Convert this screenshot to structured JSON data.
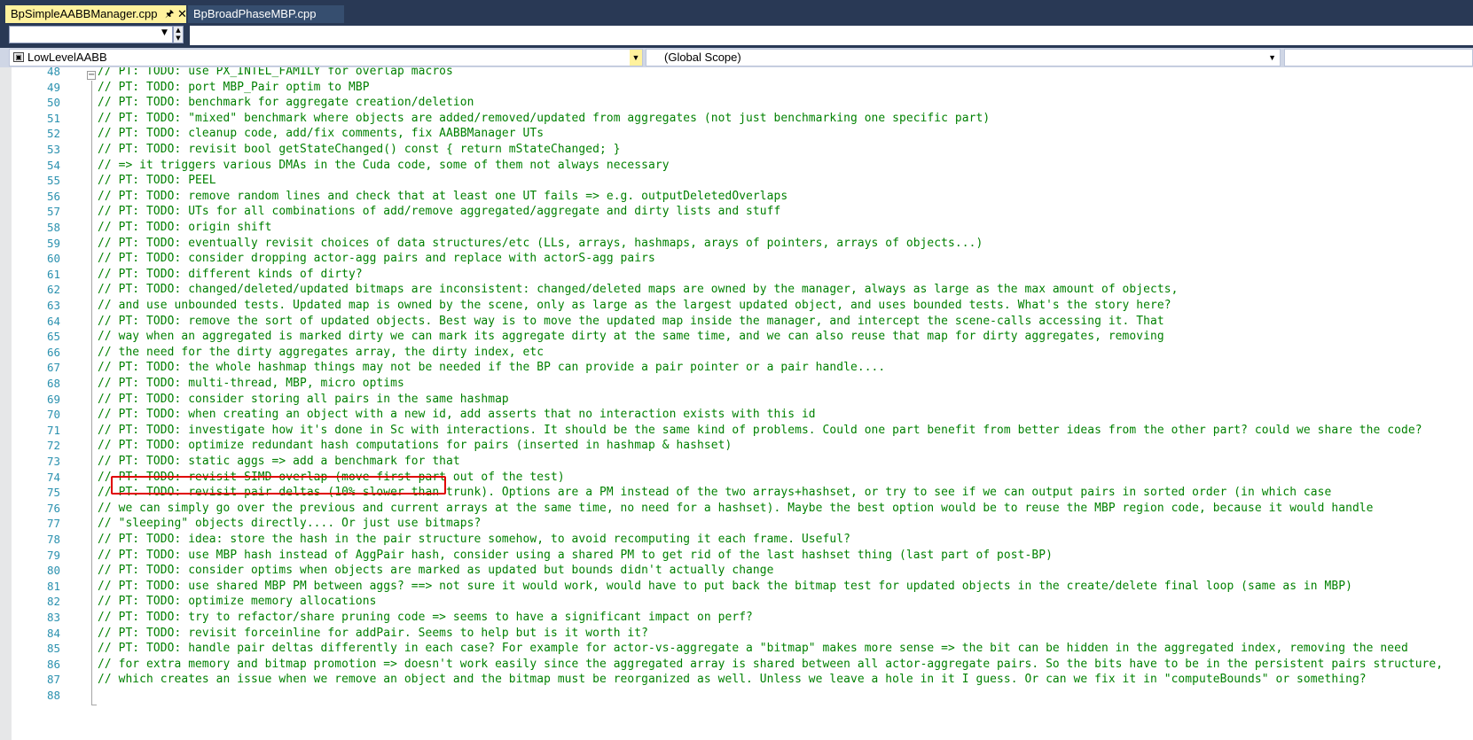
{
  "tabs": [
    {
      "label": "BpSimpleAABBManager.cpp",
      "active": true,
      "pin_icon": "pin-icon",
      "close_icon": "close-icon"
    },
    {
      "label": "BpBroadPhaseMBP.cpp",
      "active": false
    }
  ],
  "navigation": {
    "class_combo": "LowLevelAABB",
    "scope_combo": "(Global Scope)"
  },
  "editor": {
    "first_line_number": 48,
    "highlighted_line": 73,
    "lines": [
      {
        "n": "48",
        "text": "// PT: TODO: use PX_INTEL_FAMILY for overlap macros"
      },
      {
        "n": "49",
        "text": "// PT: TODO: port MBP_Pair optim to MBP"
      },
      {
        "n": "50",
        "text": "// PT: TODO: benchmark for aggregate creation/deletion"
      },
      {
        "n": "51",
        "text": "// PT: TODO: \"mixed\" benchmark where objects are added/removed/updated from aggregates (not just benchmarking one specific part)"
      },
      {
        "n": "52",
        "text": "// PT: TODO: cleanup code, add/fix comments, fix AABBManager UTs"
      },
      {
        "n": "53",
        "text": "// PT: TODO: revisit bool getStateChanged() const { return mStateChanged; }"
      },
      {
        "n": "54",
        "text": "// => it triggers various DMAs in the Cuda code, some of them not always necessary"
      },
      {
        "n": "55",
        "text": "// PT: TODO: PEEL"
      },
      {
        "n": "56",
        "text": "// PT: TODO: remove random lines and check that at least one UT fails => e.g. outputDeletedOverlaps"
      },
      {
        "n": "57",
        "text": "// PT: TODO: UTs for all combinations of add/remove aggregated/aggregate and dirty lists and stuff"
      },
      {
        "n": "58",
        "text": "// PT: TODO: origin shift"
      },
      {
        "n": "59",
        "text": "// PT: TODO: eventually revisit choices of data structures/etc (LLs, arrays, hashmaps, arays of pointers, arrays of objects...)"
      },
      {
        "n": "60",
        "text": "// PT: TODO: consider dropping actor-agg pairs and replace with actorS-agg pairs"
      },
      {
        "n": "61",
        "text": "// PT: TODO: different kinds of dirty?"
      },
      {
        "n": "62",
        "text": "// PT: TODO: changed/deleted/updated bitmaps are inconsistent: changed/deleted maps are owned by the manager, always as large as the max amount of objects,"
      },
      {
        "n": "63",
        "text": "// and use unbounded tests. Updated map is owned by the scene, only as large as the largest updated object, and uses bounded tests. What's the story here?"
      },
      {
        "n": "64",
        "text": "// PT: TODO: remove the sort of updated objects. Best way is to move the updated map inside the manager, and intercept the scene-calls accessing it. That"
      },
      {
        "n": "65",
        "text": "// way when an aggregated is marked dirty we can mark its aggregate dirty at the same time, and we can also reuse that map for dirty aggregates, removing"
      },
      {
        "n": "66",
        "text": "// the need for the dirty aggregates array, the dirty index, etc"
      },
      {
        "n": "67",
        "text": "// PT: TODO: the whole hashmap things may not be needed if the BP can provide a pair pointer or a pair handle...."
      },
      {
        "n": "68",
        "text": "// PT: TODO: multi-thread, MBP, micro optims"
      },
      {
        "n": "69",
        "text": "// PT: TODO: consider storing all pairs in the same hashmap"
      },
      {
        "n": "70",
        "text": "// PT: TODO: when creating an object with a new id, add asserts that no interaction exists with this id"
      },
      {
        "n": "71",
        "text": "// PT: TODO: investigate how it's done in Sc with interactions. It should be the same kind of problems. Could one part benefit from better ideas from the other part? could we share the code?"
      },
      {
        "n": "72",
        "text": "// PT: TODO: optimize redundant hash computations for pairs (inserted in hashmap & hashset)"
      },
      {
        "n": "73",
        "text": "// PT: TODO: static aggs => add a benchmark for that"
      },
      {
        "n": "74",
        "text": "// PT: TODO: revisit SIMD overlap (move first part out of the test)"
      },
      {
        "n": "75",
        "text": "// PT: TODO: revisit pair deltas (10% slower than trunk). Options are a PM instead of the two arrays+hashset, or try to see if we can output pairs in sorted order (in which case"
      },
      {
        "n": "76",
        "text": "// we can simply go over the previous and current arrays at the same time, no need for a hashset). Maybe the best option would be to reuse the MBP region code, because it would handle"
      },
      {
        "n": "77",
        "text": "// \"sleeping\" objects directly.... Or just use bitmaps?"
      },
      {
        "n": "78",
        "text": "// PT: TODO: idea: store the hash in the pair structure somehow, to avoid recomputing it each frame. Useful?"
      },
      {
        "n": "79",
        "text": "// PT: TODO: use MBP hash instead of AggPair hash, consider using a shared PM to get rid of the last hashset thing (last part of post-BP)"
      },
      {
        "n": "80",
        "text": "// PT: TODO: consider optims when objects are marked as updated but bounds didn't actually change"
      },
      {
        "n": "81",
        "text": "// PT: TODO: use shared MBP PM between aggs? ==> not sure it would work, would have to put back the bitmap test for updated objects in the create/delete final loop (same as in MBP)"
      },
      {
        "n": "82",
        "text": "// PT: TODO: optimize memory allocations"
      },
      {
        "n": "83",
        "text": "// PT: TODO: try to refactor/share pruning code => seems to have a significant impact on perf?"
      },
      {
        "n": "84",
        "text": "// PT: TODO: revisit forceinline for addPair. Seems to help but is it worth it?"
      },
      {
        "n": "85",
        "text": "// PT: TODO: handle pair deltas differently in each case? For example for actor-vs-aggregate a \"bitmap\" makes more sense => the bit can be hidden in the aggregated index, removing the need"
      },
      {
        "n": "86",
        "text": "// for extra memory and bitmap promotion => doesn't work easily since the aggregated array is shared between all actor-aggregate pairs. So the bits have to be in the persistent pairs structure,"
      },
      {
        "n": "87",
        "text": "// which creates an issue when we remove an object and the bitmap must be reorganized as well. Unless we leave a hole in it I guess. Or can we fix it in \"computeBounds\" or something?"
      },
      {
        "n": "88",
        "text": ""
      }
    ]
  },
  "colors": {
    "comment": "#008000",
    "line_number": "#2b91af",
    "active_tab": "#fff29d",
    "chrome": "#293955",
    "highlight_box": "#e00000"
  }
}
